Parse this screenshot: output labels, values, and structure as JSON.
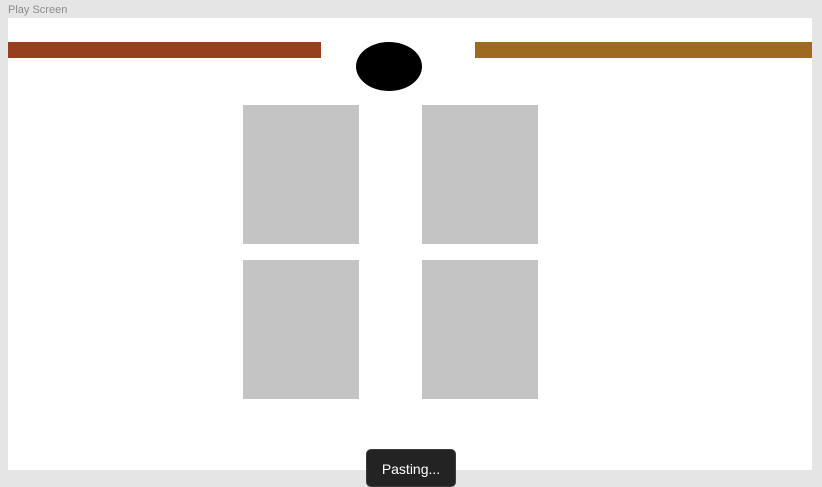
{
  "canvas": {
    "frame_label": "Play Screen"
  },
  "play_screen": {
    "left_bar_color": "#96401f",
    "right_bar_color": "#9e6a1f",
    "ball_color": "#000000",
    "card_color": "#c4c4c4",
    "cards": [
      {
        "id": "card-1"
      },
      {
        "id": "card-2"
      },
      {
        "id": "card-3"
      },
      {
        "id": "card-4"
      }
    ]
  },
  "toast": {
    "text": "Pasting..."
  }
}
